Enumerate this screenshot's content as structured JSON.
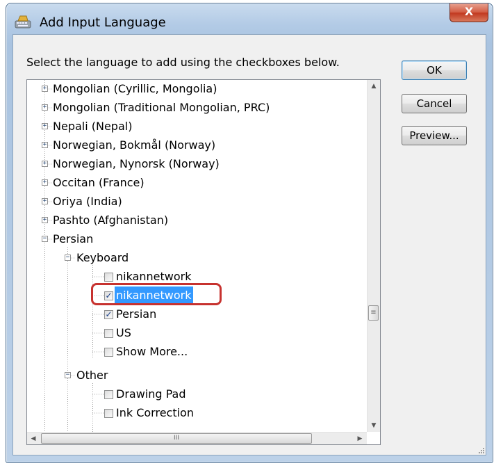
{
  "window": {
    "title": "Add Input Language",
    "close_label": "X"
  },
  "instruction": "Select the language to add using the checkboxes below.",
  "buttons": {
    "ok": "OK",
    "cancel": "Cancel",
    "preview": "Preview..."
  },
  "tree": {
    "languages": [
      "Mongolian (Cyrillic, Mongolia)",
      "Mongolian (Traditional Mongolian, PRC)",
      "Nepali (Nepal)",
      "Norwegian, Bokmål (Norway)",
      "Norwegian, Nynorsk (Norway)",
      "Occitan (France)",
      "Oriya (India)",
      "Pashto (Afghanistan)"
    ],
    "expanded_language": "Persian",
    "keyboard_group": "Keyboard",
    "keyboard_items": [
      {
        "label": "nikannetwork",
        "checked": false
      },
      {
        "label": "nikannetwork",
        "checked": true,
        "selected": true
      },
      {
        "label": "Persian",
        "checked": true
      },
      {
        "label": "US",
        "checked": false
      },
      {
        "label": "Show More...",
        "checked": false
      }
    ],
    "other_group": "Other",
    "other_items": [
      {
        "label": "Drawing Pad",
        "checked": false
      },
      {
        "label": "Ink Correction",
        "checked": false
      }
    ]
  },
  "scrollbars": {
    "h_thumb_glyph": "III",
    "v_thumb_glyph": "≡"
  },
  "colors": {
    "selection": "#3399ff",
    "highlight_ring": "#c7322f",
    "check": "#1b3f86"
  }
}
